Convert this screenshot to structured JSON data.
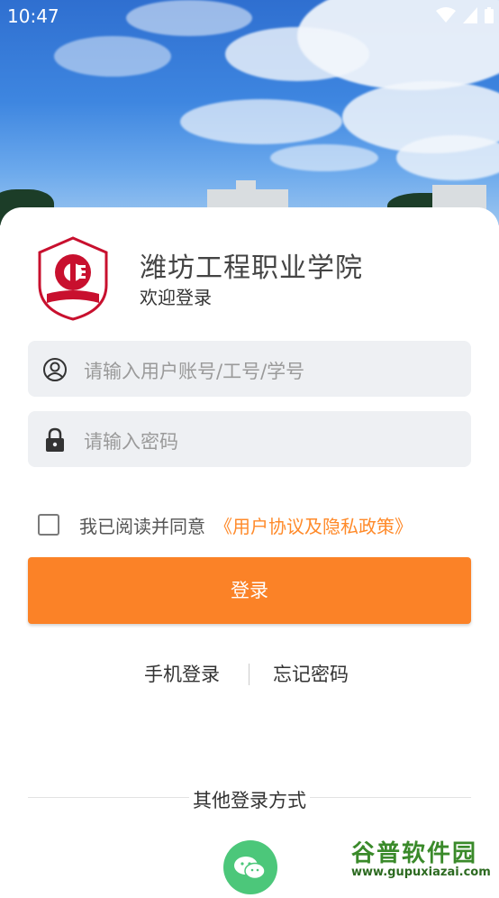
{
  "status_bar": {
    "time": "10:47"
  },
  "header": {
    "title": "潍坊工程职业学院",
    "subtitle": "欢迎登录",
    "logo_text": "潍坊工程职业学院"
  },
  "form": {
    "account_placeholder": "请输入用户账号/工号/学号",
    "password_placeholder": "请输入密码"
  },
  "agreement": {
    "checked": false,
    "text": "我已阅读并同意",
    "link": "《用户协议及隐私政策》"
  },
  "login_button": "登录",
  "links": {
    "phone_login": "手机登录",
    "forgot_password": "忘记密码"
  },
  "other_login": {
    "label": "其他登录方式",
    "methods": [
      "wechat-icon"
    ]
  },
  "watermark": {
    "top": "谷普软件园",
    "bottom": "www.gupuxiazai.com"
  },
  "colors": {
    "accent": "#fb8227",
    "link": "#ff8a2a",
    "wechat": "#4cc77a"
  }
}
